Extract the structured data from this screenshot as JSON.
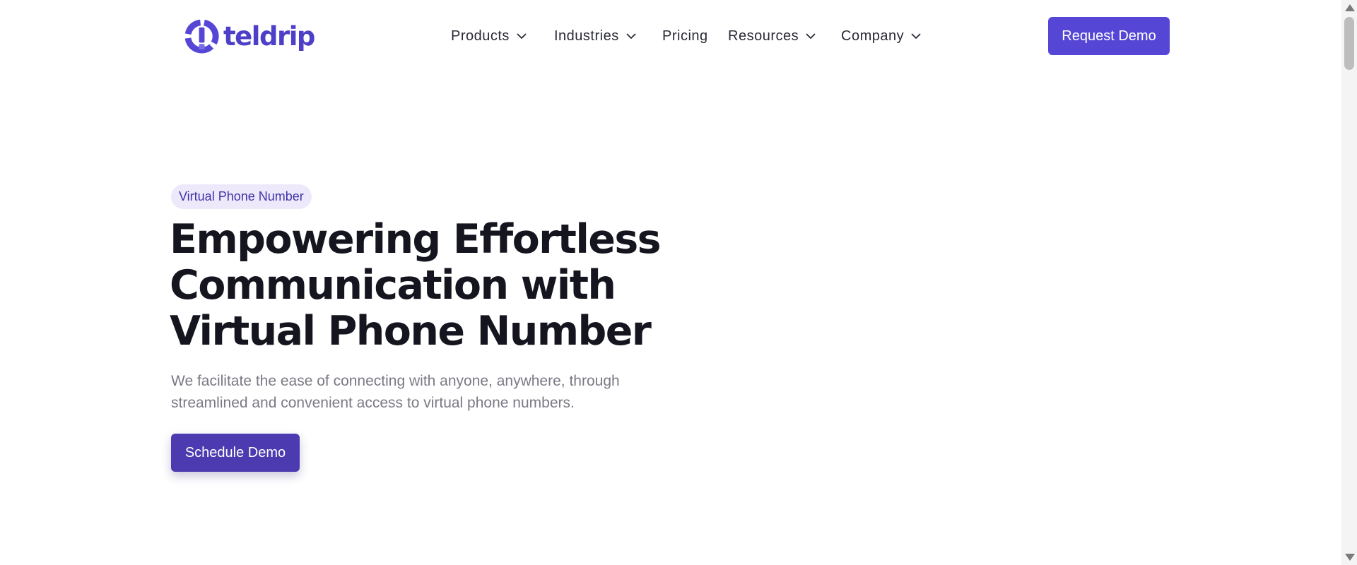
{
  "header": {
    "logo_text": "teldrip",
    "nav": [
      {
        "label": "Products",
        "has_dropdown": true
      },
      {
        "label": "Industries",
        "has_dropdown": true
      },
      {
        "label": "Pricing",
        "has_dropdown": false
      },
      {
        "label": "Resources",
        "has_dropdown": true
      },
      {
        "label": "Company",
        "has_dropdown": true
      }
    ],
    "cta_label": "Request Demo"
  },
  "hero": {
    "badge": "Virtual Phone Number",
    "title_lines": [
      "Empowering Effortless",
      "Communication with",
      "Virtual Phone Number"
    ],
    "subtitle_lines": [
      "We facilitate the ease of connecting with anyone, anywhere, through",
      "streamlined and convenient access to virtual phone numbers."
    ],
    "cta_label": "Schedule Demo"
  },
  "colors": {
    "brand": "#5646d6",
    "brand_dark": "#4b3ab0",
    "badge_bg": "#ede9fb",
    "heading": "#15151f",
    "muted_text": "#7a7a85"
  },
  "icons": {
    "logo": "teldrip-logo-icon",
    "dropdown": "chevron-down-icon"
  }
}
